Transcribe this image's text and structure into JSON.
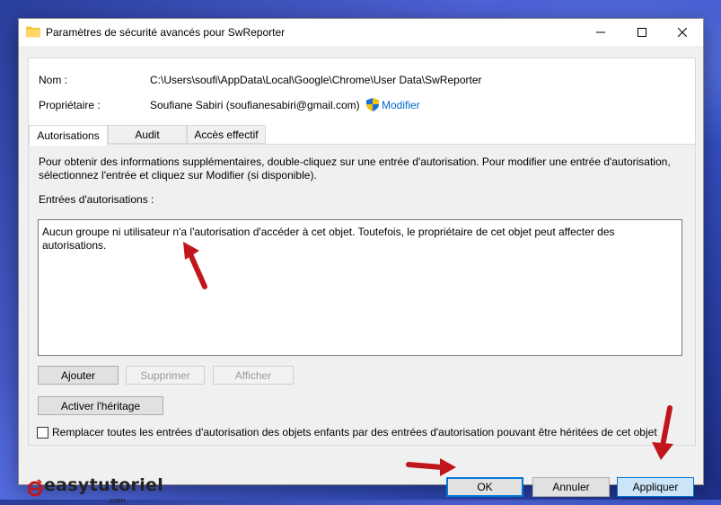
{
  "window": {
    "title": "Paramètres de sécurité avancés pour SwReporter",
    "minimize_icon": "minimize-icon",
    "maximize_icon": "maximize-icon",
    "close_icon": "close-icon"
  },
  "header": {
    "name_label": "Nom :",
    "name_value": "C:\\Users\\soufi\\AppData\\Local\\Google\\Chrome\\User Data\\SwReporter",
    "owner_label": "Propriétaire :",
    "owner_value": "Soufiane Sabiri (soufianesabiri@gmail.com)",
    "modify_link": "Modifier",
    "shield_icon": "uac-shield-icon"
  },
  "tabs": [
    {
      "label": "Autorisations",
      "active": true
    },
    {
      "label": "Audit",
      "active": false
    },
    {
      "label": "Accès effectif",
      "active": false
    }
  ],
  "permissions": {
    "info_line1": "Pour obtenir des informations supplémentaires, double-cliquez sur une entrée d'autorisation. Pour modifier une entrée d'autorisation,",
    "info_line2": "sélectionnez l'entrée et cliquez sur Modifier (si disponible).",
    "entries_label": "Entrées d'autorisations :",
    "entries_message_line1": "Aucun groupe ni utilisateur n'a l'autorisation d'accéder à cet objet. Toutefois, le propriétaire de cet objet peut affecter des",
    "entries_message_line2": "autorisations.",
    "add_button": "Ajouter",
    "remove_button": "Supprimer",
    "view_button": "Afficher",
    "inheritance_button": "Activer l'héritage",
    "replace_checkbox_label": "Remplacer toutes les entrées d'autorisation des objets enfants par des entrées d'autorisation pouvant être héritées de cet objet",
    "replace_checkbox_checked": false
  },
  "footer": {
    "ok_button": "OK",
    "cancel_button": "Annuler",
    "apply_button": "Appliquer",
    "brand_text": "easytutoriel",
    "brand_suffix": ".com"
  },
  "colors": {
    "annotation_arrow": "#c0151b",
    "accent": "#0078d7"
  }
}
